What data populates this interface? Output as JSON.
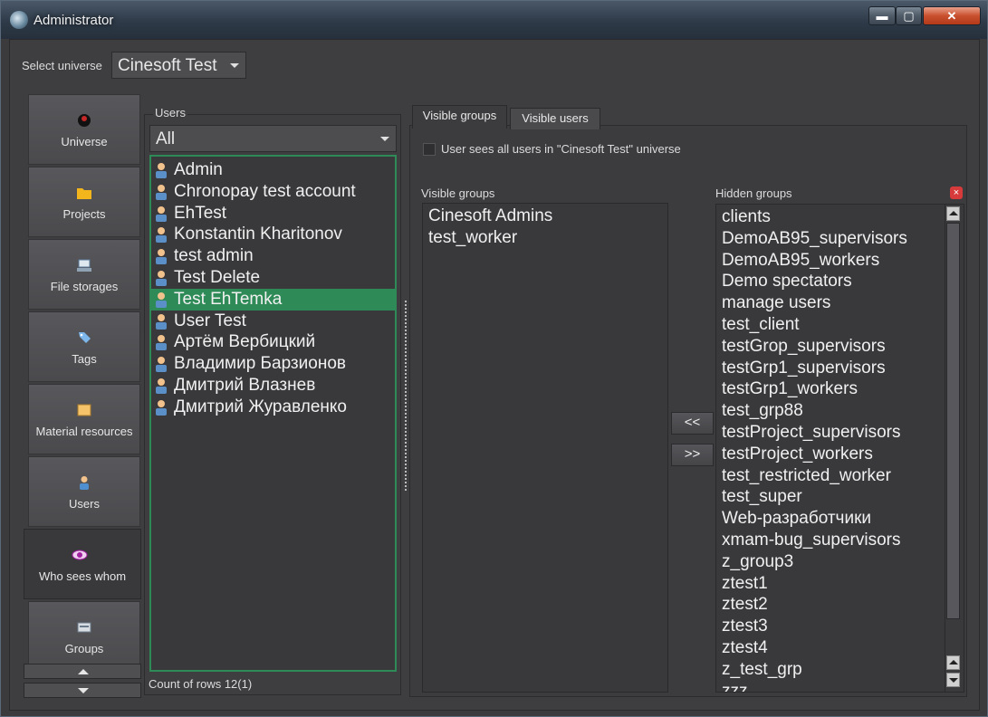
{
  "window": {
    "title": "Administrator",
    "minimize": "▬",
    "maximize": "▢",
    "close": "✕"
  },
  "universe": {
    "label": "Select universe",
    "selected": "Cinesoft Test"
  },
  "nav": {
    "items": [
      {
        "label": "Universe",
        "icon": "universe-icon"
      },
      {
        "label": "Projects",
        "icon": "folder-icon"
      },
      {
        "label": "File storages",
        "icon": "storage-icon"
      },
      {
        "label": "Tags",
        "icon": "tag-icon"
      },
      {
        "label": "Material resources",
        "icon": "box-icon"
      },
      {
        "label": "Users",
        "icon": "user-icon"
      },
      {
        "label": "Who sees whom",
        "icon": "eye-icon",
        "active": true
      },
      {
        "label": "Groups",
        "icon": "groups-icon"
      }
    ]
  },
  "users": {
    "title": "Users",
    "filter": "All",
    "items": [
      "Admin",
      "Chronopay test account",
      "EhTest",
      "Konstantin Kharitonov",
      "test admin",
      "Test Delete",
      "Test EhTemka",
      "User Test",
      "Артём Вербицкий",
      "Владимир Барзионов",
      "Дмитрий Влазнев",
      "Дмитрий Журавленко"
    ],
    "selected_index": 6,
    "count_text": "Count of rows 12(1)"
  },
  "tabs": [
    {
      "label": "Visible groups",
      "active": true
    },
    {
      "label": "Visible users",
      "active": false
    }
  ],
  "option": {
    "label": "User sees all users in \"Cinesoft Test\" universe",
    "checked": false
  },
  "visible_groups": {
    "title": "Visible groups",
    "items": [
      "Cinesoft Admins",
      "test_worker"
    ]
  },
  "hidden_groups": {
    "title": "Hidden groups",
    "items": [
      "clients",
      "DemoAB95_supervisors",
      "DemoAB95_workers",
      "Demo spectators",
      "manage users",
      "test_client",
      "testGrop_supervisors",
      "testGrp1_supervisors",
      "testGrp1_workers",
      "test_grp88",
      "testProject_supervisors",
      "testProject_workers",
      "test_restricted_worker",
      "test_super",
      "Web-разработчики",
      "xmam-bug_supervisors",
      "z_group3",
      "ztest1",
      "ztest2",
      "ztest3",
      "ztest4",
      "z_test_grp",
      "zzz"
    ]
  },
  "buttons": {
    "add": "<<",
    "remove": ">>"
  },
  "colors": {
    "selection": "#2e8b57",
    "background": "#3e3e41",
    "close_badge": "#d63a3a"
  }
}
